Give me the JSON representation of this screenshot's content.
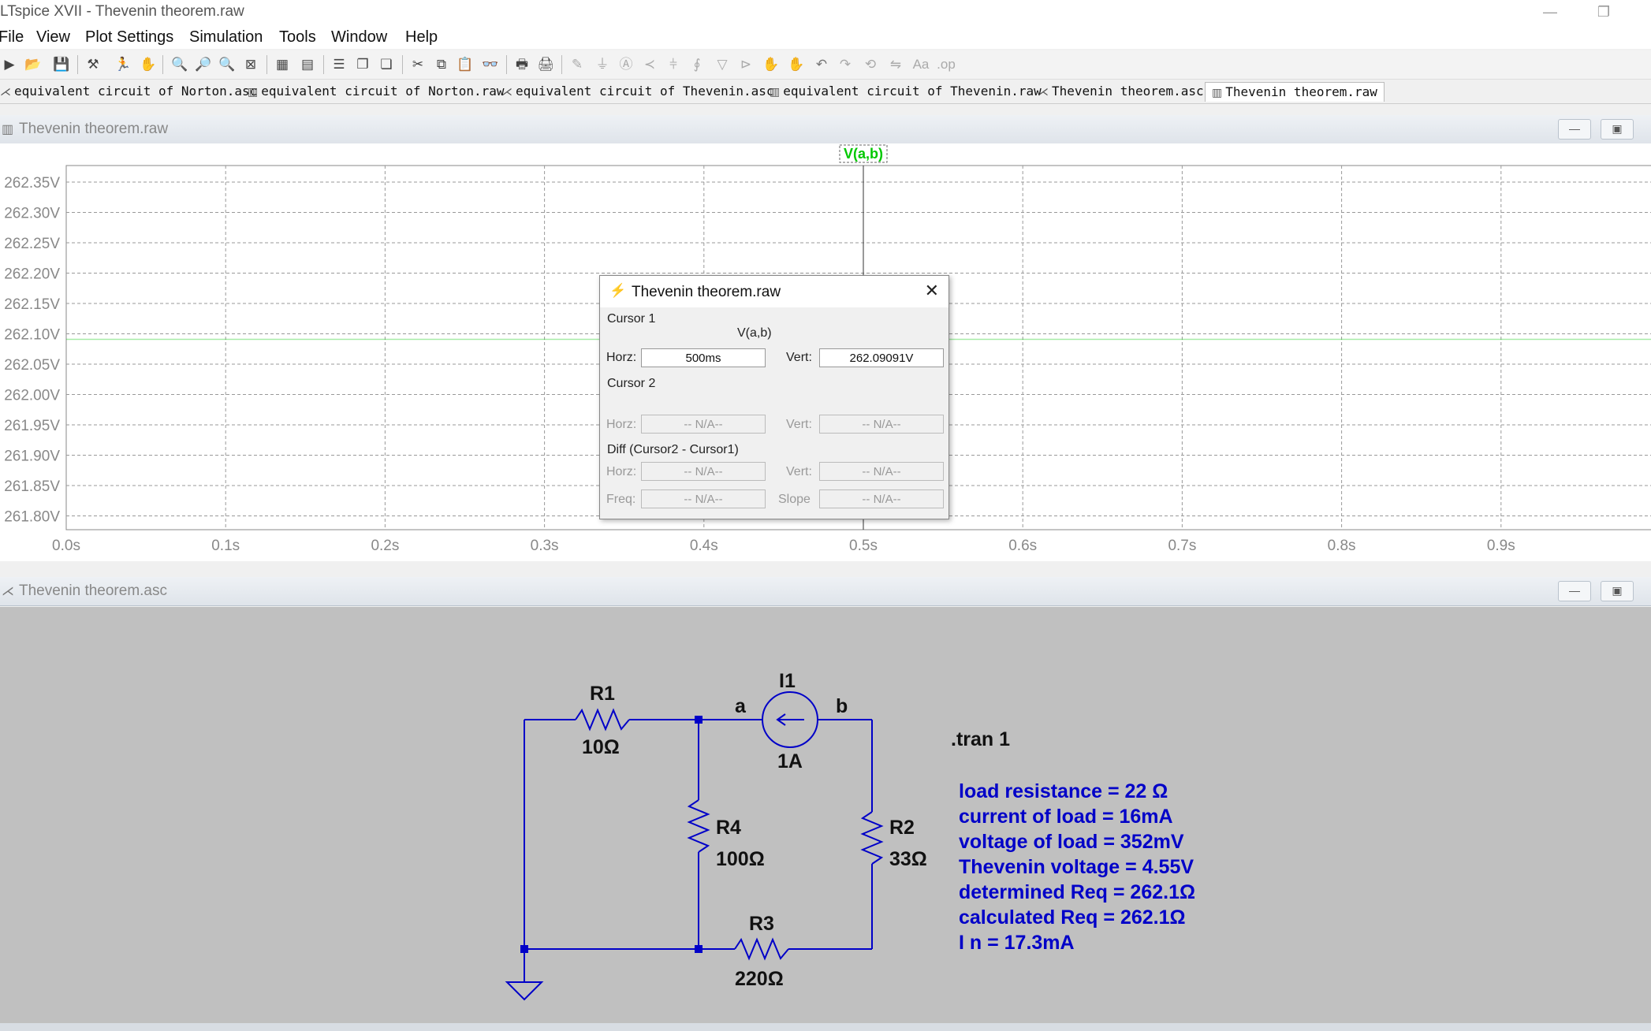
{
  "window": {
    "title": "LTspice XVII - Thevenin theorem.raw",
    "minimize_glyph": "—",
    "restore_glyph": "❐"
  },
  "menu": [
    "File",
    "View",
    "Plot Settings",
    "Simulation",
    "Tools",
    "Window",
    "Help"
  ],
  "tabs": [
    {
      "label": "equivalent circuit of Norton.asc",
      "icon": "schematic-icon"
    },
    {
      "label": "equivalent circuit of Norton.raw",
      "icon": "waveform-icon"
    },
    {
      "label": "equivalent circuit of Thevenin.asc",
      "icon": "schematic-icon"
    },
    {
      "label": "equivalent circuit of Thevenin.raw",
      "icon": "waveform-icon"
    },
    {
      "label": "Thevenin theorem.asc",
      "icon": "schematic-icon"
    },
    {
      "label": "Thevenin theorem.raw",
      "icon": "waveform-icon",
      "active": true
    }
  ],
  "plot_window": {
    "title": "Thevenin theorem.raw",
    "trace_label": "V(a,b)",
    "trace_color": "#00c800"
  },
  "chart_data": {
    "type": "line",
    "title": "",
    "xlabel": "",
    "ylabel": "",
    "x_ticks": [
      "0.0s",
      "0.1s",
      "0.2s",
      "0.3s",
      "0.4s",
      "0.5s",
      "0.6s",
      "0.7s",
      "0.8s",
      "0.9s"
    ],
    "y_ticks": [
      "262.35V",
      "262.30V",
      "262.25V",
      "262.20V",
      "262.15V",
      "262.10V",
      "262.05V",
      "262.00V",
      "261.95V",
      "261.90V",
      "261.85V",
      "261.80V"
    ],
    "xlim": [
      0,
      1.0
    ],
    "ylim": [
      261.8,
      262.4
    ],
    "grid": true,
    "series": [
      {
        "name": "V(a,b)",
        "x": [
          0,
          1.0
        ],
        "y": [
          262.09091,
          262.09091
        ]
      }
    ],
    "cursor_x": 0.5
  },
  "cursor_dialog": {
    "title": "Thevenin theorem.raw",
    "cursor1_label": "Cursor 1",
    "trace": "V(a,b)",
    "horz_label": "Horz:",
    "vert_label": "Vert:",
    "cursor1_horz": "500ms",
    "cursor1_vert": "262.09091V",
    "cursor2_label": "Cursor 2",
    "cursor2_horz": "-- N/A--",
    "cursor2_vert": "-- N/A--",
    "diff_label": "Diff (Cursor2 - Cursor1)",
    "diff_horz": "-- N/A--",
    "diff_vert": "-- N/A--",
    "freq_label": "Freq:",
    "freq": "-- N/A--",
    "slope_label": "Slope",
    "slope": "-- N/A--"
  },
  "schematic_window": {
    "title": "Thevenin theorem.asc",
    "wire_color": "#0000c8",
    "components": {
      "r1_name": "R1",
      "r1_value": "10Ω",
      "r4_name": "R4",
      "r4_value": "100Ω",
      "r2_name": "R2",
      "r2_value": "33Ω",
      "r3_name": "R3",
      "r3_value": "220Ω",
      "i1_name": "I1",
      "i1_value": "1A",
      "node_a": "a",
      "node_b": "b"
    },
    "directive": ".tran 1",
    "notes": [
      "load resistance = 22 Ω",
      "current of load = 16mA",
      "voltage of load = 352mV",
      "Thevenin voltage = 4.55V",
      "determined Req = 262.1Ω",
      "calculated Req = 262.1Ω",
      "I n = 17.3mA"
    ]
  }
}
